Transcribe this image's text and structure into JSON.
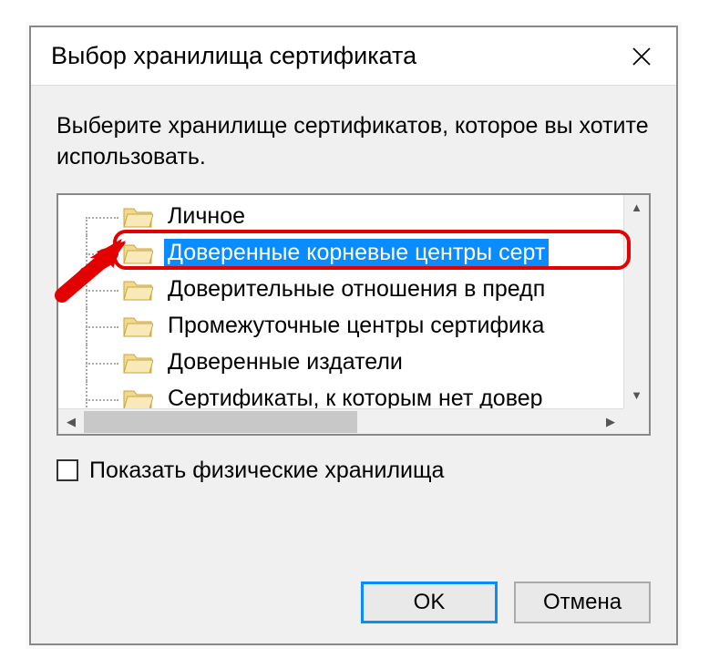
{
  "dialog": {
    "title": "Выбор хранилища сертификата",
    "instruction": "Выберите хранилище сертификатов, которое вы хотите использовать."
  },
  "tree": {
    "items": [
      {
        "label": "Личное",
        "selected": false
      },
      {
        "label": "Доверенные корневые центры серт",
        "selected": true
      },
      {
        "label": "Доверительные отношения в предп",
        "selected": false
      },
      {
        "label": "Промежуточные центры сертифика",
        "selected": false
      },
      {
        "label": "Доверенные издатели",
        "selected": false
      },
      {
        "label": "Сертификаты, к которым нет довер",
        "selected": false
      }
    ]
  },
  "checkbox": {
    "label": "Показать физические хранилища",
    "checked": false
  },
  "buttons": {
    "ok": "OK",
    "cancel": "Отмена"
  }
}
